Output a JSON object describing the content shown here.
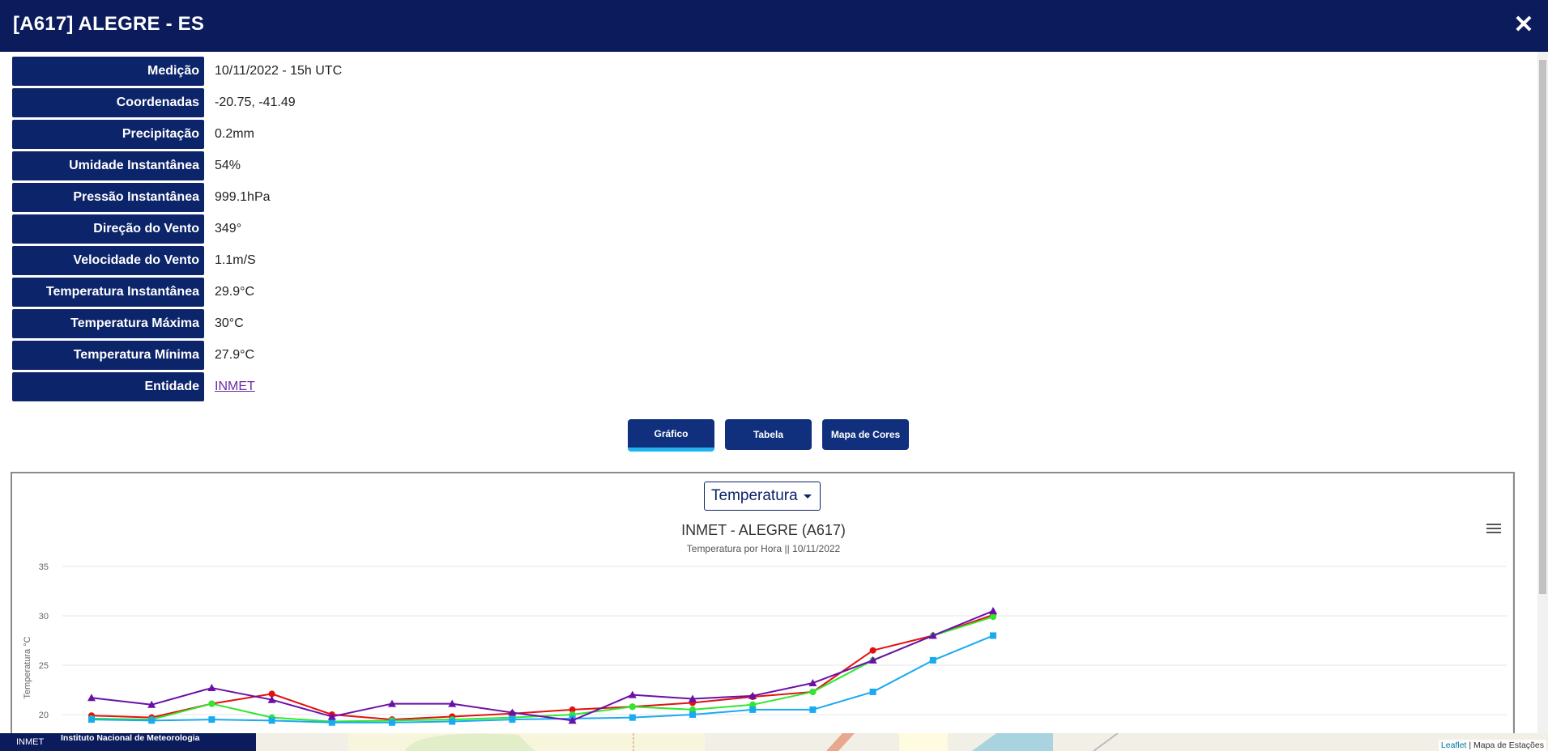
{
  "header": {
    "title": "[A617] ALEGRE - ES",
    "close_icon": "close-icon"
  },
  "info": [
    {
      "label": "Medição",
      "value": "10/11/2022 - 15h UTC"
    },
    {
      "label": "Coordenadas",
      "value": "-20.75, -41.49"
    },
    {
      "label": "Precipitação",
      "value": "0.2mm"
    },
    {
      "label": "Umidade Instantânea",
      "value": "54%"
    },
    {
      "label": "Pressão Instantânea",
      "value": "999.1hPa"
    },
    {
      "label": "Direção do Vento",
      "value": "349°"
    },
    {
      "label": "Velocidade do Vento",
      "value": "1.1m/S"
    },
    {
      "label": "Temperatura Instantânea",
      "value": "29.9°C"
    },
    {
      "label": "Temperatura Máxima",
      "value": "30°C"
    },
    {
      "label": "Temperatura Mínima",
      "value": "27.9°C"
    },
    {
      "label": "Entidade",
      "value": "INMET"
    }
  ],
  "tabs": {
    "grafico": "Gráfico",
    "tabela": "Tabela",
    "mapa": "Mapa de Cores",
    "active": "grafico"
  },
  "select": {
    "value": "Temperatura"
  },
  "chart": {
    "title": "INMET - ALEGRE (A617)",
    "subtitle": "Temperatura por Hora || 10/11/2022",
    "menu_icon": "hamburger-menu-icon"
  },
  "chart_data": {
    "type": "line",
    "title": "INMET - ALEGRE (A617)",
    "subtitle": "Temperatura por Hora || 10/11/2022",
    "ylabel": "Temperatura °C",
    "yticks": [
      20,
      25,
      30,
      35
    ],
    "ylim": [
      17,
      35
    ],
    "x": [
      0,
      1,
      2,
      3,
      4,
      5,
      6,
      7,
      8,
      9,
      10,
      11,
      12,
      13,
      14,
      15
    ],
    "grid": true,
    "series": [
      {
        "color": "#e41010",
        "marker": "circle",
        "values": [
          19.9,
          19.7,
          21.1,
          22.1,
          20.0,
          19.5,
          19.8,
          20.1,
          20.5,
          20.8,
          21.2,
          21.8,
          22.3,
          26.5,
          28.0,
          30.1
        ]
      },
      {
        "color": "#2ee82e",
        "marker": "circle",
        "values": [
          19.6,
          19.5,
          21.1,
          19.7,
          19.3,
          19.4,
          19.5,
          19.7,
          20.0,
          20.8,
          20.5,
          21.0,
          22.3,
          25.5,
          28.0,
          29.9
        ]
      },
      {
        "color": "#1aaaf0",
        "marker": "square",
        "values": [
          19.5,
          19.4,
          19.5,
          19.4,
          19.2,
          19.2,
          19.3,
          19.5,
          19.6,
          19.7,
          20.0,
          20.5,
          20.5,
          22.3,
          25.5,
          28.0
        ]
      },
      {
        "color": "#6a10a8",
        "marker": "triangle",
        "values": [
          21.7,
          21.0,
          22.7,
          21.5,
          19.8,
          21.1,
          21.1,
          20.2,
          19.4,
          22.0,
          21.6,
          21.9,
          23.2,
          25.5,
          28.0,
          30.5
        ]
      }
    ]
  },
  "footer": {
    "brand_short": "INMET",
    "brand_long": "Instituto Nacional de Meteorologia",
    "attrib_link": "Leaflet",
    "attrib_text": "| Mapa de Estações"
  }
}
